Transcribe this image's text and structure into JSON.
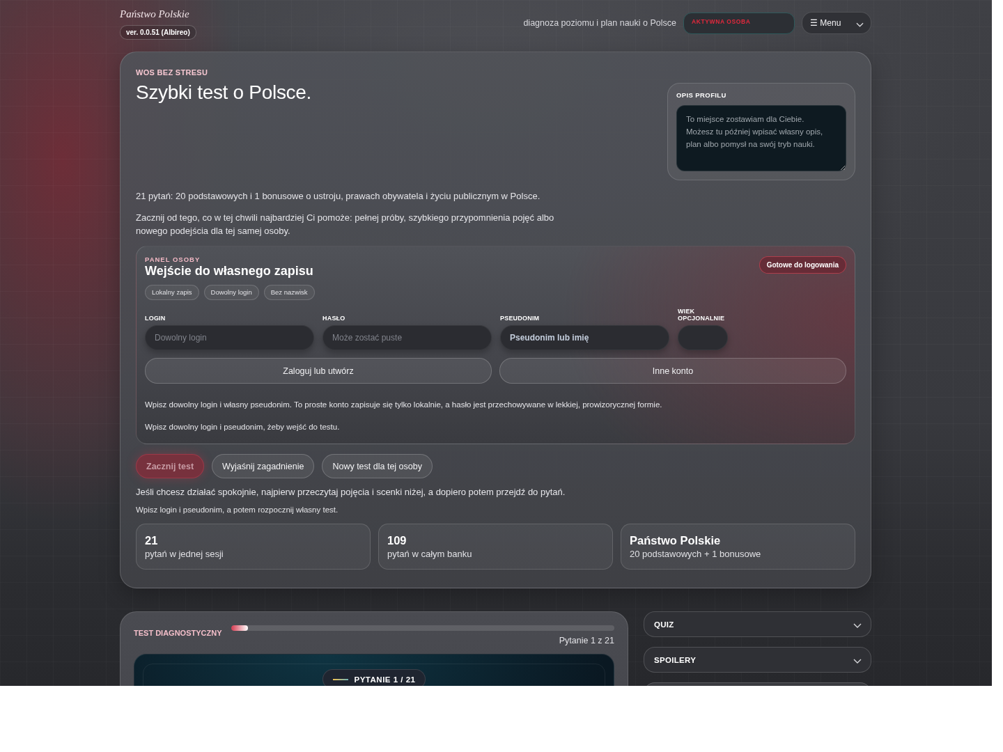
{
  "header": {
    "brand": "Państwo Polskie",
    "version": "ver. 0.0.51 (Albireo)",
    "tagline": "diagnoza poziomu i plan nauki o Polsce",
    "active_person": {
      "label": "AKTYWNA OSOBA"
    },
    "menu_button": {
      "label": "☰ Menu"
    }
  },
  "hero": {
    "eyebrow": "WOS BEZ STRESU",
    "title": "Szybki test o Polsce.",
    "profile": {
      "label": "OPIS PROFILU",
      "placeholder": "To miejsce zostawiam dla Ciebie. Możesz tu później wpisać własny opis, plan albo pomysł na swój tryb nauki."
    },
    "intro": [
      "21 pytań: 20 podstawowych i 1 bonusowe o ustroju, prawach obywatela i życiu publicznym w Polsce.",
      "Zacznij od tego, co w tej chwili najbardziej Ci pomoże: pełnej próby, szybkiego przypomnienia pojęć albo nowego podejścia dla tej samej osoby."
    ]
  },
  "panel": {
    "eyebrow": "PANEL OSOBY",
    "title": "Wejście do własnego zapisu",
    "status": "Gotowe do logowania",
    "chips": [
      "Lokalny zapis",
      "Dowolny login",
      "Bez nazwisk"
    ],
    "fields": [
      {
        "label": "LOGIN",
        "kind": "text",
        "placeholder": "Dowolny login"
      },
      {
        "label": "HASŁO",
        "kind": "text",
        "placeholder": "Może zostać puste"
      },
      {
        "label": "PSEUDONIM",
        "kind": "text",
        "value": "Pseudonim lub imię"
      },
      {
        "label": "WIEK OPCJONALNIE",
        "kind": "number"
      }
    ],
    "buttons": [
      "Zaloguj lub utwórz",
      "Inne konto"
    ],
    "notes": [
      "Wpisz dowolny login i własny pseudonim. To proste konto zapisuje się tylko lokalnie, a hasło jest przechowywane w lekkiej, prowizorycznej formie.",
      "Wpisz dowolny login i pseudonim, żeby wejść do testu."
    ]
  },
  "actions": [
    {
      "label": "Zacznij test",
      "kind": "primary",
      "disabled": true
    },
    {
      "label": "Wyjaśnij zagadnienie",
      "kind": "secondary",
      "disabled": false
    },
    {
      "label": "Nowy test dla tej osoby",
      "kind": "secondary",
      "disabled": false
    }
  ],
  "hints": [
    "Jeśli chcesz działać spokojnie, najpierw przeczytaj pojęcia i scenki niżej, a dopiero potem przejdź do pytań.",
    "Wpisz login i pseudonim, a potem rozpocznij własny test."
  ],
  "stats": [
    {
      "value": "21",
      "label": "pytań w jednej sesji"
    },
    {
      "value": "109",
      "label": "pytań w całym banku"
    },
    {
      "value": "Państwo Polskie",
      "label": "20 podstawowych + 1 bonusowe"
    }
  ],
  "test": {
    "label": "TEST DIAGNOSTYCZNY",
    "progress": {
      "level": 0.045
    },
    "counter": "Pytanie 1 z 21",
    "question_badge": "PYTANIE 1 / 21"
  },
  "sidebar": {
    "sections": [
      {
        "title": "QUIZ",
        "expanded": false
      },
      {
        "title": "SPOILERY",
        "expanded": false
      }
    ]
  }
}
